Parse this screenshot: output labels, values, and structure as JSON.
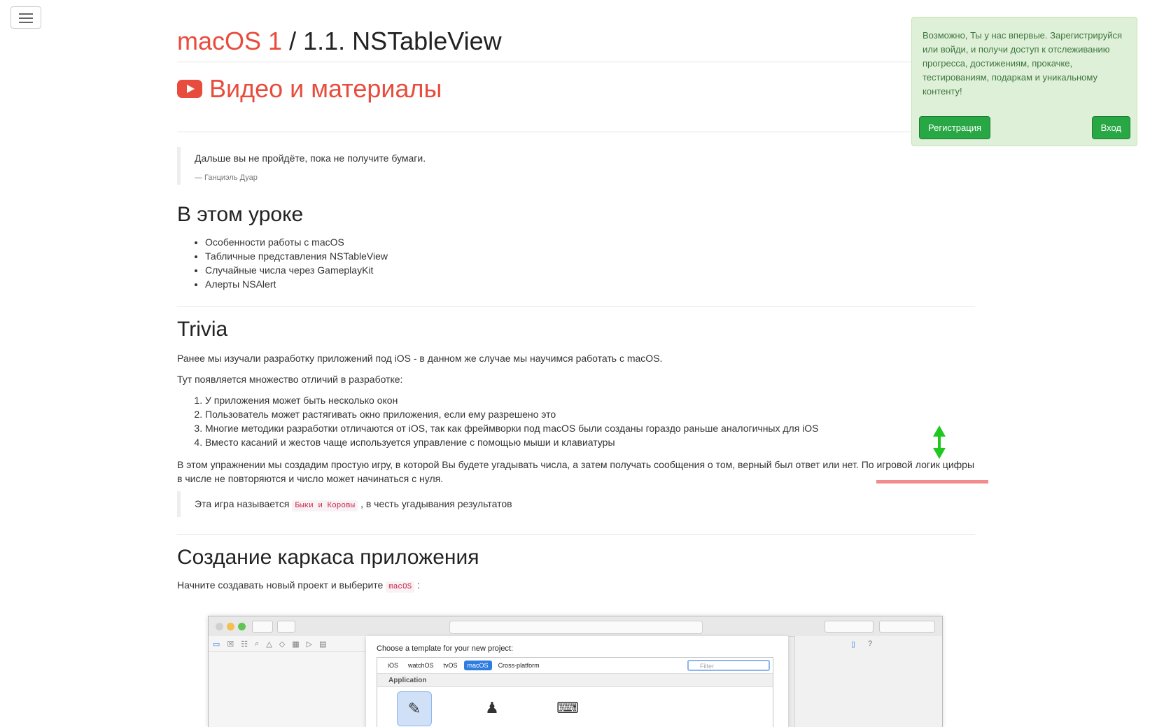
{
  "header": {
    "crumb": "macOS 1",
    "separator": "/",
    "title": "1.1. NSTableView"
  },
  "video": {
    "heading": "Видео и материалы"
  },
  "epigraph": {
    "text": "Дальше вы не пройдёте, пока не получите бумаги.",
    "author": "— Ганциэль Дуар"
  },
  "lesson": {
    "heading": "В этом уроке",
    "items": [
      "Особенности работы с macOS",
      "Табличные представления NSTableView",
      "Случайные числа через GameplayKit",
      "Алерты NSAlert"
    ]
  },
  "trivia": {
    "heading": "Trivia",
    "p1": "Ранее мы изучали разработку приложений под iOS - в данном же случае мы научимся работать с macOS.",
    "p2": "Тут появляется множество отличий в разработке:",
    "items": [
      "У приложения может быть несколько окон",
      "Пользователь может растягивать окно приложения, если ему разрешено это",
      "Многие методики разработки отличаются от iOS, так как фреймворки под macOS были созданы гораздо раньше аналогичных для iOS",
      "Вместо касаний и жестов чаще используется управление с помощью мыши и клавиатуры"
    ],
    "p3": "В этом упражнении мы создадим простую игру, в которой Вы будете угадывать числа, а затем получать сообщения о том, верный был ответ или нет. По игровой логик цифры в числе не повторяются и число может начинаться с нуля.",
    "quote_before": "Эта игра называется",
    "quote_code": "Быки и Коровы",
    "quote_after": ", в честь угадывания результатов"
  },
  "skeleton": {
    "heading": "Создание каркаса приложения",
    "p_before": "Начните создавать новый проект и выберите",
    "p_code": "macOS",
    "p_after": ":"
  },
  "toast": {
    "text": "Возможно, Ты у нас впервые. Зарегистрируйся или войди, и получи доступ к отслеживанию прогресса, достижениям, прокачке, тестированиям, подаркам и уникальному контенту!",
    "register": "Регистрация",
    "login": "Вход"
  },
  "xcode": {
    "sheet_title": "Choose a template for your new project:",
    "tabs": [
      "iOS",
      "watchOS",
      "tvOS",
      "macOS",
      "Cross-platform"
    ],
    "active_tab": "macOS",
    "filter_placeholder": "Filter",
    "section": "Application"
  },
  "colors": {
    "accent": "#e74c3c",
    "success": "#28a745",
    "toast_bg": "#dff0d8"
  }
}
